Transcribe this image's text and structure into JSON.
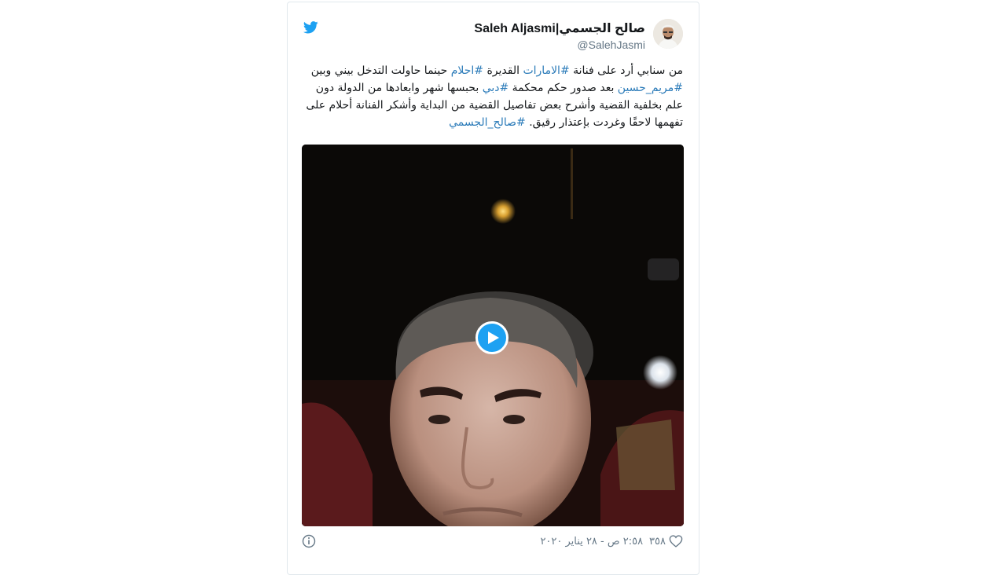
{
  "author": {
    "display_name": "Saleh Aljasmi|صالح الجسمي",
    "handle": "@SalehJasmi"
  },
  "tweet": {
    "segments": [
      {
        "text": "من سنابي أرد على فنانة ",
        "hashtag": false
      },
      {
        "text": "#الامارات",
        "hashtag": true
      },
      {
        "text": " القديرة ",
        "hashtag": false
      },
      {
        "text": "#احلام",
        "hashtag": true
      },
      {
        "text": " حينما حاولت التدخل بيني وبين ",
        "hashtag": false
      },
      {
        "text": "#مريم_حسين",
        "hashtag": true
      },
      {
        "text": " بعد صدور حكم محكمة ",
        "hashtag": false
      },
      {
        "text": "#دبي",
        "hashtag": true
      },
      {
        "text": " بحبسها شهر وابعادها من الدولة دون علم بخلفية القضية وأشرح بعض تفاصيل القضية من البداية وأشكر الفنانة أحلام على تفهمها لاحقًا وغردت بإعتذار رقيق. ",
        "hashtag": false
      },
      {
        "text": "#صالح_الجسمي",
        "hashtag": true
      }
    ]
  },
  "footer": {
    "likes": "٣٥٨",
    "timestamp": "٢:٥٨ ص - ٢٨ يناير ٢٠٢٠"
  },
  "icons": {
    "brand": "twitter-bird-icon",
    "play": "play-icon",
    "like": "heart-icon",
    "info": "info-icon"
  },
  "colors": {
    "brand": "#1da1f2",
    "hashtag": "#2b7bb9",
    "text": "#14171a",
    "muted": "#657786"
  }
}
